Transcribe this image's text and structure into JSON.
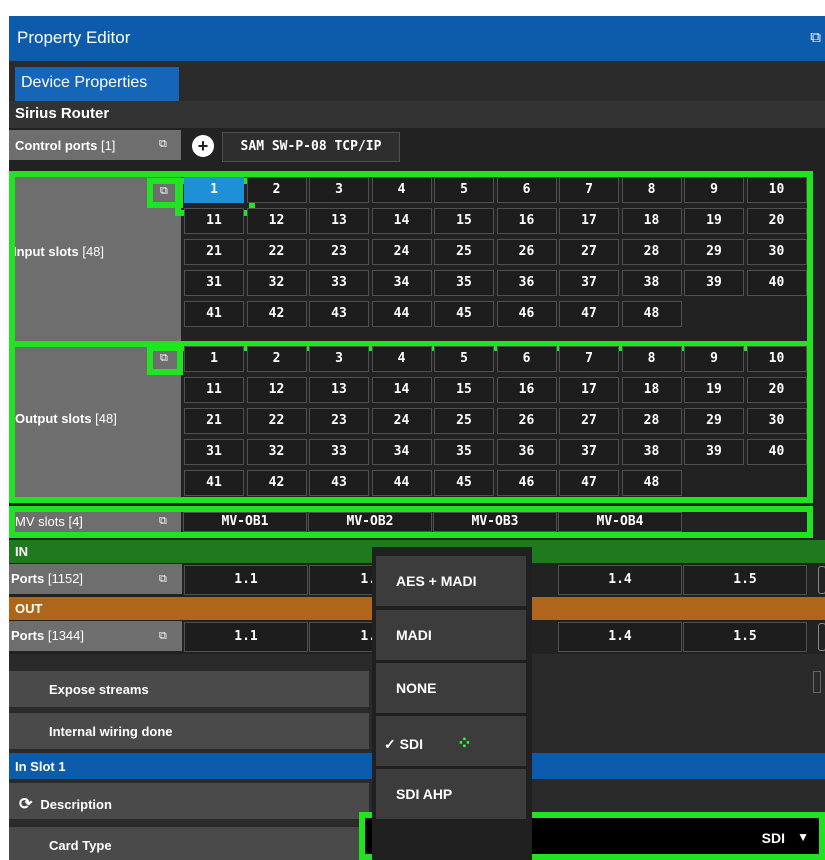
{
  "window": {
    "title": "Property Editor",
    "title_icon": "detach-icon"
  },
  "tabs": [
    {
      "label": "Device Properties",
      "active": true
    }
  ],
  "device": {
    "name": "Sirius Router"
  },
  "control_ports": {
    "label": "Control ports",
    "count": "[1]",
    "protocol_label": "SAM SW-P-08 TCP/IP"
  },
  "input_slots": {
    "label": "Input slots",
    "count": "[48]",
    "selected": "1",
    "slots": [
      "1",
      "2",
      "3",
      "4",
      "5",
      "6",
      "7",
      "8",
      "9",
      "10",
      "11",
      "12",
      "13",
      "14",
      "15",
      "16",
      "17",
      "18",
      "19",
      "20",
      "21",
      "22",
      "23",
      "24",
      "25",
      "26",
      "27",
      "28",
      "29",
      "30",
      "31",
      "32",
      "33",
      "34",
      "35",
      "36",
      "37",
      "38",
      "39",
      "40",
      "41",
      "42",
      "43",
      "44",
      "45",
      "46",
      "47",
      "48"
    ]
  },
  "output_slots": {
    "label": "Output slots",
    "count": "[48]",
    "slots": [
      "1",
      "2",
      "3",
      "4",
      "5",
      "6",
      "7",
      "8",
      "9",
      "10",
      "11",
      "12",
      "13",
      "14",
      "15",
      "16",
      "17",
      "18",
      "19",
      "20",
      "21",
      "22",
      "23",
      "24",
      "25",
      "26",
      "27",
      "28",
      "29",
      "30",
      "31",
      "32",
      "33",
      "34",
      "35",
      "36",
      "37",
      "38",
      "39",
      "40",
      "41",
      "42",
      "43",
      "44",
      "45",
      "46",
      "47",
      "48"
    ]
  },
  "mv_slots": {
    "label": "MV slots",
    "count": "[4]",
    "slots": [
      "MV-OB1",
      "MV-OB2",
      "MV-OB3",
      "MV-OB4"
    ]
  },
  "in_section": {
    "title": "IN",
    "color": "#1f7a1f",
    "ports_label": "Ports",
    "ports_count": "[1152]",
    "ports": [
      "1.1",
      "1.",
      "1.4",
      "1.5"
    ]
  },
  "out_section": {
    "title": "OUT",
    "color": "#b0661a",
    "ports_label": "Ports",
    "ports_count": "[1344]",
    "ports": [
      "1.1",
      "1.",
      "1.4",
      "1.5"
    ]
  },
  "properties": {
    "expose_streams": "Expose streams",
    "internal_wiring": "Internal wiring done",
    "in_slot_header": "In Slot 1",
    "description": "Description",
    "card_type": "Card Type"
  },
  "card_type_dropdown": {
    "options": [
      "AES + MADI",
      "MADI",
      "NONE",
      "SDI",
      "SDI AHP"
    ],
    "selected": "SDI",
    "check": "✓",
    "value": "SDI",
    "arrow": "▼"
  },
  "colors": {
    "highlight": "#22e322",
    "titlebar": "#0d5cab",
    "selected_slot": "#1e90d8"
  }
}
